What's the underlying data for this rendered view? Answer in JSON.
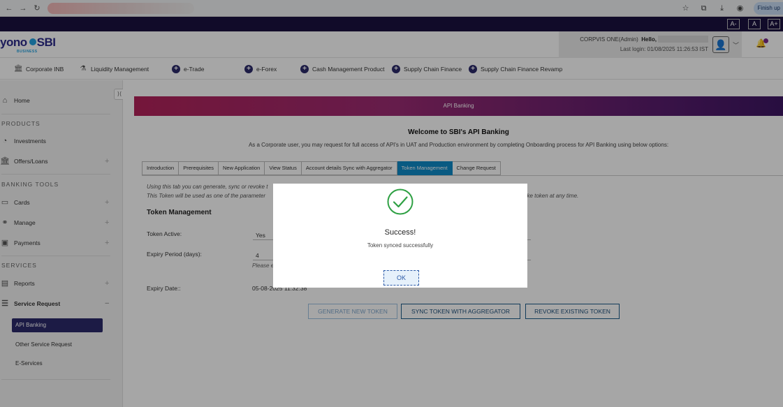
{
  "browser": {
    "finish_label": "Finish up"
  },
  "fontsize": {
    "decrease": "A-",
    "normal": "A",
    "increase": "A+"
  },
  "header": {
    "logo_text": "yono",
    "logo_sbi": "SBI",
    "logo_sub": "BUSINESS",
    "user_role": "CORPVIS ONE(Admin)",
    "hello": "Hello,",
    "last_login": "Last login: 01/08/2025 11:26:53 IST"
  },
  "menu": {
    "items": [
      {
        "label": "Corporate INB"
      },
      {
        "label": "Liquidity Management"
      },
      {
        "label": "e-Trade"
      },
      {
        "label": "e-Forex"
      },
      {
        "label": "Cash Management Product"
      },
      {
        "label": "Supply Chain Finance"
      },
      {
        "label": "Supply Chain Finance Revamp"
      }
    ]
  },
  "sidebar": {
    "home": "Home",
    "sections": [
      "PRODUCTS",
      "BANKING TOOLS",
      "SERVICES"
    ],
    "investments": "Investments",
    "offers": "Offers/Loans",
    "cards": "Cards",
    "manage": "Manage",
    "payments": "Payments",
    "reports": "Reports",
    "service_request": "Service Request",
    "sub_items": [
      "API Banking",
      "Other Service Request",
      "E-Services"
    ]
  },
  "main": {
    "banner": "API Banking",
    "welcome_title": "Welcome to SBI's API Banking",
    "welcome_sub": "As a Corporate user, you may request for full access of API's in UAT and Production environment by completing Onboarding process for API Banking using below options:",
    "tabs": [
      {
        "label": "Introduction"
      },
      {
        "label": "Prerequisites"
      },
      {
        "label": "New Application"
      },
      {
        "label": "View Status"
      },
      {
        "label": "Account details Sync with Aggregator"
      },
      {
        "label": "Token Management"
      },
      {
        "label": "Change Request"
      }
    ],
    "intro_line1": "Using this tab you can generate, sync or revoke t",
    "intro_line2": "This Token will be used as one of the parameter",
    "intro_tail": "oke token at any time.",
    "section_heading": "Token Management",
    "fields": {
      "token_active_label": "Token Active:",
      "token_active_value": "Yes",
      "expiry_period_label": "Expiry Period (days):",
      "expiry_period_value": "4",
      "expiry_note": "Please e",
      "expiry_date_label": "Expiry Date::",
      "expiry_date_value": "05-08-2025 11:32:38"
    },
    "buttons": {
      "generate": "GENERATE NEW TOKEN",
      "sync": "SYNC TOKEN WITH AGGREGATOR",
      "revoke": "REVOKE EXISTING TOKEN"
    }
  },
  "modal": {
    "title": "Success!",
    "message": "Token synced successfully",
    "ok": "OK"
  },
  "colors": {
    "brand_dark": "#1b1240",
    "active_tab": "#0f8ac8",
    "success_green": "#2ea043"
  }
}
